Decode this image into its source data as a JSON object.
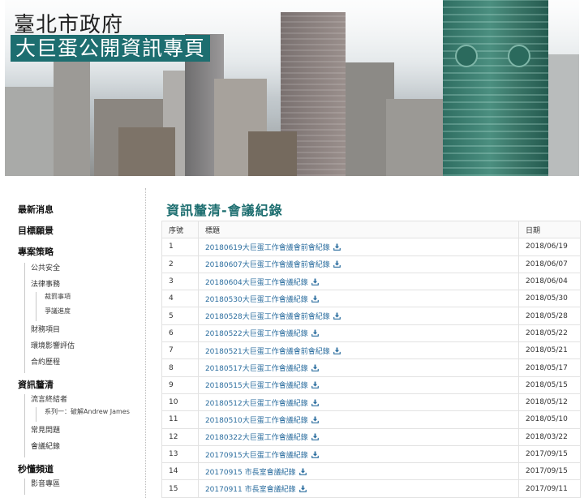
{
  "header": {
    "city_title": "臺北市政府",
    "site_title": "大巨蛋公開資訊專頁"
  },
  "sidebar": {
    "items": [
      {
        "label": "最新消息"
      },
      {
        "label": "目標願景"
      },
      {
        "label": "專案策略",
        "children": [
          {
            "label": "公共安全"
          },
          {
            "label": "法律事務",
            "children": [
              {
                "label": "裁罰事項"
              },
              {
                "label": "爭議進度"
              }
            ]
          },
          {
            "label": "財務項目"
          },
          {
            "label": "環境影響評估"
          },
          {
            "label": "合約歷程"
          }
        ]
      },
      {
        "label": "資訊釐清",
        "children": [
          {
            "label": "流言終結者",
            "children": [
              {
                "label": "系列一：破解Andrew James"
              }
            ]
          },
          {
            "label": "常見問題"
          },
          {
            "label": "會議紀錄"
          }
        ]
      },
      {
        "label": "秒懂頻道",
        "children": [
          {
            "label": "影音專區"
          }
        ]
      }
    ]
  },
  "main": {
    "page_title": "資訊釐清-會議紀錄",
    "table": {
      "headers": {
        "no": "序號",
        "title": "標題",
        "date": "日期"
      },
      "rows": [
        {
          "no": "1",
          "title": "20180619大巨蛋工作會議會前會紀錄",
          "date": "2018/06/19"
        },
        {
          "no": "2",
          "title": "20180607大巨蛋工作會議會前會紀錄",
          "date": "2018/06/07"
        },
        {
          "no": "3",
          "title": "20180604大巨蛋工作會議紀錄",
          "date": "2018/06/04"
        },
        {
          "no": "4",
          "title": "20180530大巨蛋工作會議紀錄",
          "date": "2018/05/30"
        },
        {
          "no": "5",
          "title": "20180528大巨蛋工作會議會前會紀錄",
          "date": "2018/05/28"
        },
        {
          "no": "6",
          "title": "20180522大巨蛋工作會議紀錄",
          "date": "2018/05/22"
        },
        {
          "no": "7",
          "title": "20180521大巨蛋工作會議會前會紀錄",
          "date": "2018/05/21"
        },
        {
          "no": "8",
          "title": "20180517大巨蛋工作會議紀錄",
          "date": "2018/05/17"
        },
        {
          "no": "9",
          "title": "20180515大巨蛋工作會議紀錄",
          "date": "2018/05/15"
        },
        {
          "no": "10",
          "title": "20180512大巨蛋工作會議紀錄",
          "date": "2018/05/12"
        },
        {
          "no": "11",
          "title": "20180510大巨蛋工作會議紀錄",
          "date": "2018/05/10"
        },
        {
          "no": "12",
          "title": "20180322大巨蛋工作會議紀錄",
          "date": "2018/03/22"
        },
        {
          "no": "13",
          "title": "20170915大巨蛋工作會議紀錄",
          "date": "2017/09/15"
        },
        {
          "no": "14",
          "title": "20170915 市長室會議紀錄",
          "date": "2017/09/15"
        },
        {
          "no": "15",
          "title": "20170911 市長室會議紀錄",
          "date": "2017/09/11"
        }
      ]
    }
  },
  "icons": {
    "download": "download-icon"
  },
  "colors": {
    "accent": "#1d6e70",
    "link": "#2c6e9f"
  }
}
